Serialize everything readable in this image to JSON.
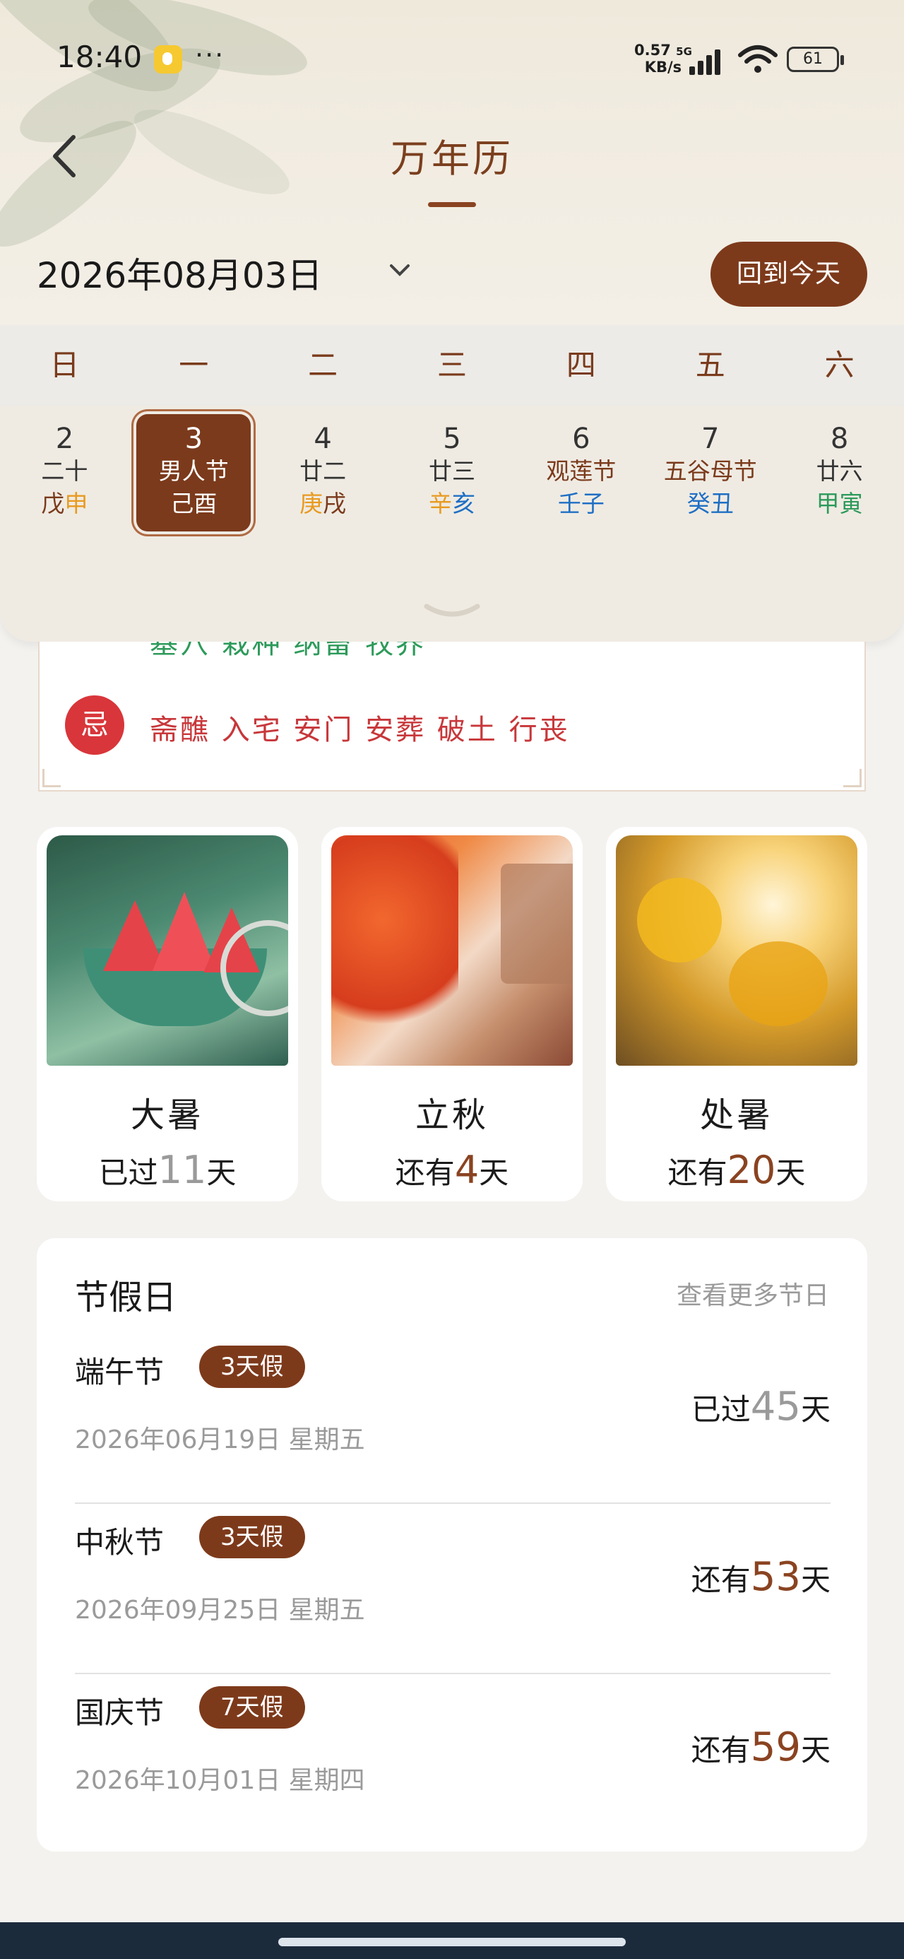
{
  "status": {
    "time": "18:40",
    "net_speed_value": "0.57",
    "net_speed_unit": "KB/s",
    "network": "5G",
    "battery": "61"
  },
  "header": {
    "title": "万年历",
    "date": "2026年08月03日",
    "today_button": "回到今天"
  },
  "weekdays": [
    "日",
    "一",
    "二",
    "三",
    "四",
    "五",
    "六"
  ],
  "days": [
    {
      "num": "2",
      "lunar": "二十",
      "gz1": "戊",
      "gz2": "申",
      "gz1_color": "#7b3a1b",
      "gz2_color": "#e89a20"
    },
    {
      "num": "3",
      "lunar": "男人节",
      "gz1": "己",
      "gz2": "酉",
      "selected": true
    },
    {
      "num": "4",
      "lunar": "廿二",
      "gz1": "庚",
      "gz2": "戌",
      "gz1_color": "#e89a20",
      "gz2_color": "#7b3a1b"
    },
    {
      "num": "5",
      "lunar": "廿三",
      "gz1": "辛",
      "gz2": "亥",
      "gz1_color": "#e89a20",
      "gz2_color": "#1f6fc4"
    },
    {
      "num": "6",
      "lunar": "观莲节",
      "gz1": "壬",
      "gz2": "子",
      "lunar_color": "#7b3a1b",
      "gz1_color": "#1f6fc4",
      "gz2_color": "#1f6fc4"
    },
    {
      "num": "7",
      "lunar": "五谷母节",
      "gz1": "癸",
      "gz2": "丑",
      "lunar_color": "#7b3a1b",
      "gz1_color": "#1f6fc4",
      "gz2_color": "#1f6fc4"
    },
    {
      "num": "8",
      "lunar": "廿六",
      "gz1": "甲",
      "gz2": "寅",
      "gz1_color": "#2d9a5a",
      "gz2_color": "#2d9a5a"
    }
  ],
  "almanac": {
    "yi_items": "基穴 栽种 纳畜 牧养",
    "ji_label": "忌",
    "ji_items": "斋醮 入宅 安门 安葬 破土 行丧"
  },
  "solar_terms": [
    {
      "name": "大暑",
      "prefix": "已过",
      "days": "11",
      "suffix": "天",
      "past": true
    },
    {
      "name": "立秋",
      "prefix": "还有",
      "days": "4",
      "suffix": "天",
      "past": false
    },
    {
      "name": "处暑",
      "prefix": "还有",
      "days": "20",
      "suffix": "天",
      "past": false
    }
  ],
  "holidays": {
    "title": "节假日",
    "more": "查看更多节日",
    "items": [
      {
        "name": "端午节",
        "tag": "3天假",
        "date": "2026年06月19日 星期五",
        "prefix": "已过",
        "days": "45",
        "suffix": "天",
        "past": true
      },
      {
        "name": "中秋节",
        "tag": "3天假",
        "date": "2026年09月25日 星期五",
        "prefix": "还有",
        "days": "53",
        "suffix": "天",
        "past": false
      },
      {
        "name": "国庆节",
        "tag": "7天假",
        "date": "2026年10月01日 星期四",
        "prefix": "还有",
        "days": "59",
        "suffix": "天",
        "past": false
      }
    ]
  },
  "colors": {
    "accent": "#7d3a1b",
    "yi": "#2d9a5a",
    "ji": "#d8363a"
  }
}
